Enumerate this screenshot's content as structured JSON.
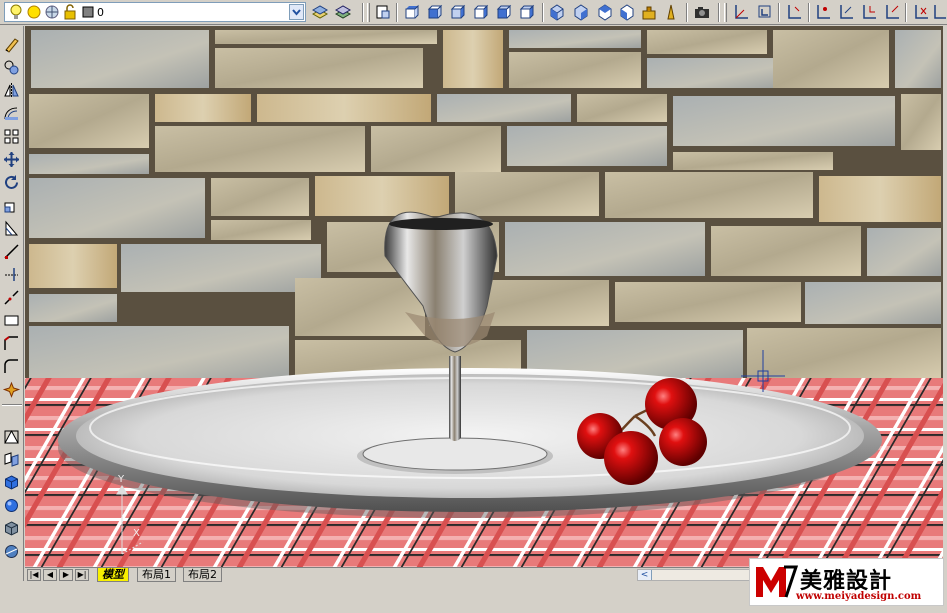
{
  "toolbar": {
    "layer_name": "0"
  },
  "tabs": [
    {
      "label": "模型",
      "active": true
    },
    {
      "label": "布局1",
      "active": false
    },
    {
      "label": "布局2",
      "active": false
    }
  ],
  "nav_buttons": [
    "|◀",
    "◀",
    "▶",
    "▶|"
  ],
  "scroll": {
    "left_arrow": "<"
  },
  "logo": {
    "text": "美雅設計",
    "url": "www.meiyadesign.com",
    "brand_color": "#cc0000"
  },
  "ucs": {
    "y_label": "Y",
    "x_label": "X"
  },
  "colors": {
    "toolbar_bg": "#d4d0c8",
    "active_tab": "#f8f000"
  }
}
